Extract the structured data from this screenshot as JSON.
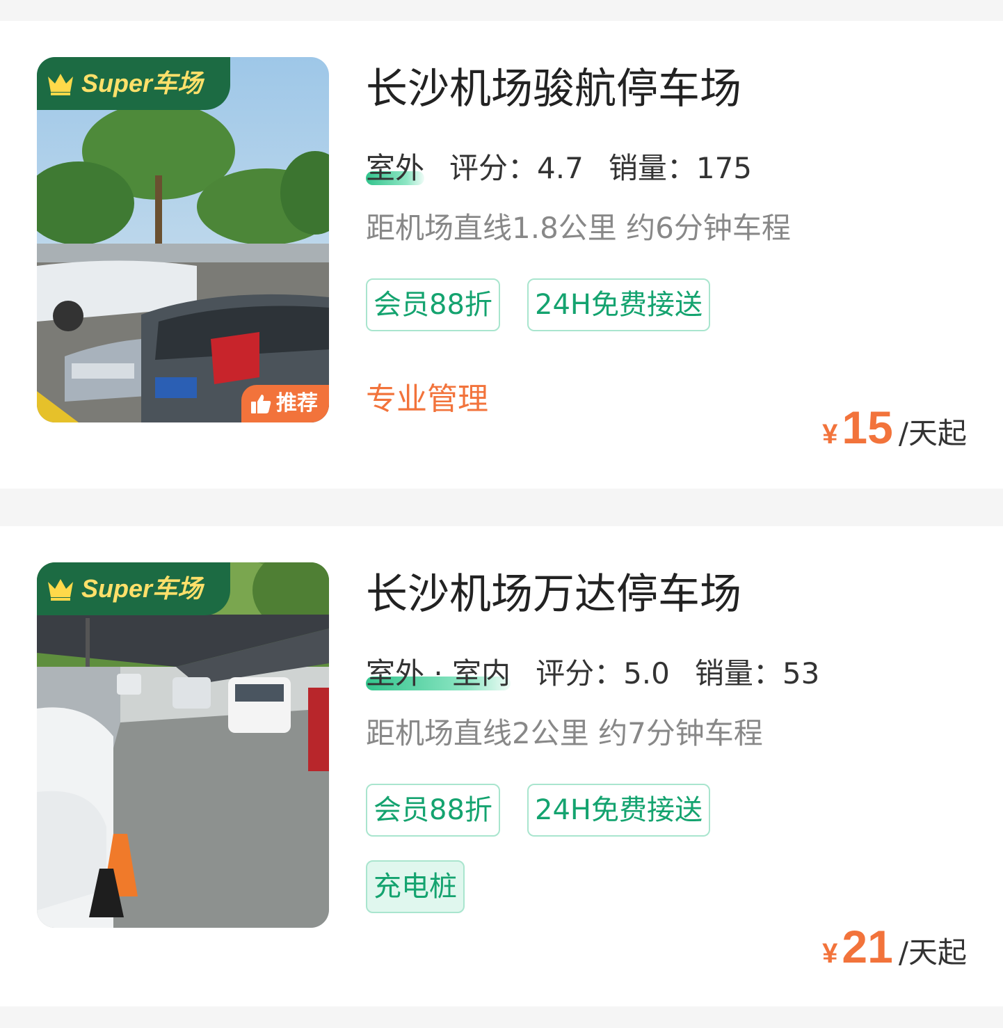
{
  "listings": [
    {
      "badge": "Super车场",
      "recommend_label": "推荐",
      "title": "长沙机场骏航停车场",
      "parking_type": "室外",
      "rating_label": "评分：",
      "rating": "4.7",
      "sales_label": "销量：",
      "sales": "175",
      "distance": "距机场直线1.8公里 约6分钟车程",
      "tags": [
        "会员88折",
        "24H免费接送"
      ],
      "feature": "专业管理",
      "currency": "¥",
      "price": "15",
      "price_unit": "/天起"
    },
    {
      "badge": "Super车场",
      "title": "长沙机场万达停车场",
      "parking_type": "室外 · 室内",
      "rating_label": "评分：",
      "rating": "5.0",
      "sales_label": "销量：",
      "sales": "53",
      "distance": "距机场直线2公里 约7分钟车程",
      "tags": [
        "会员88折",
        "24H免费接送"
      ],
      "service_tag": "充电桩",
      "currency": "¥",
      "price": "21",
      "price_unit": "/天起"
    }
  ],
  "colors": {
    "badge_bg": "#1c6b43",
    "badge_text": "#ffe06a",
    "accent_orange": "#f2733b",
    "tag_green": "#14a36f",
    "tag_border": "#a9e5ce"
  },
  "icons": {
    "badge": "crown-icon",
    "recommend": "thumbs-up-icon"
  }
}
